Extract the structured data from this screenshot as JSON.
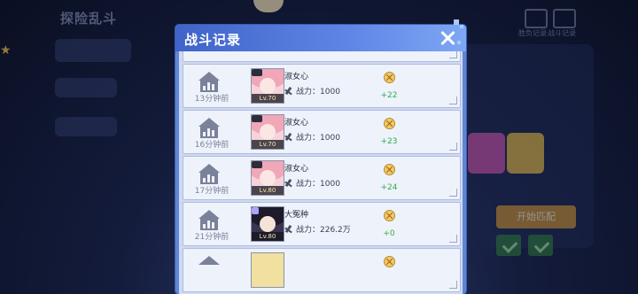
{
  "background": {
    "title": "探险乱斗",
    "subtitle": "",
    "right_buttons": [
      {
        "label": "胜负记录"
      },
      {
        "label": "战斗记录"
      }
    ],
    "side_button": "开始匹配"
  },
  "dialog": {
    "title": "战斗记录",
    "close_icon": "close-icon",
    "records": [
      {
        "time": "13分钟前",
        "name": "淑女心",
        "level": "Lv.70",
        "power_label": "战力：",
        "power_value": "1000",
        "delta": "+22",
        "avatar_style": "pink"
      },
      {
        "time": "16分钟前",
        "name": "淑女心",
        "level": "Lv.70",
        "power_label": "战力：",
        "power_value": "1000",
        "delta": "+23",
        "avatar_style": "pink"
      },
      {
        "time": "17分钟前",
        "name": "淑女心",
        "level": "Lv.80",
        "power_label": "战力：",
        "power_value": "1000",
        "delta": "+24",
        "avatar_style": "pink"
      },
      {
        "time": "21分钟前",
        "name": "大冤种",
        "level": "Lv.80",
        "power_label": "战力：",
        "power_value": "226.2万",
        "delta": "+0",
        "avatar_style": "dark"
      }
    ]
  },
  "colors": {
    "header": "#4f74d8",
    "row_bg": "#eef2fb",
    "delta_green": "#2fae48",
    "time_gray": "#7a8299"
  }
}
